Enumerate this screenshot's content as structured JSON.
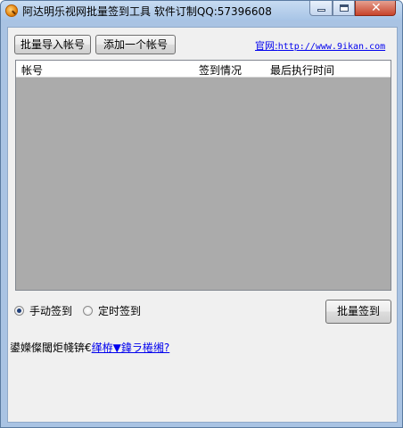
{
  "window": {
    "title": "阿达明乐视网批量签到工具 软件订制QQ:57396608",
    "close_glyph": "✕"
  },
  "toolbar": {
    "import_label": "批量导入帐号",
    "add_label": "添加一个帐号"
  },
  "site": {
    "label": "官网:",
    "url": "http://www.9ikan.com"
  },
  "table": {
    "columns": [
      "帐号",
      "签到情况",
      "最后执行时间"
    ],
    "rows": []
  },
  "mode": {
    "manual_label": "手动签到",
    "timer_label": "定时签到",
    "selected": "manual"
  },
  "actions": {
    "batch_label": "批量签到"
  },
  "status": {
    "text": "鍙嬫儏閾炬帴锛€",
    "link": "缂栫▼鍏ラ棬缃?"
  },
  "colors": {
    "titlebar": "#b9d1ea",
    "list_background": "#ababab",
    "link": "#0000ee"
  }
}
